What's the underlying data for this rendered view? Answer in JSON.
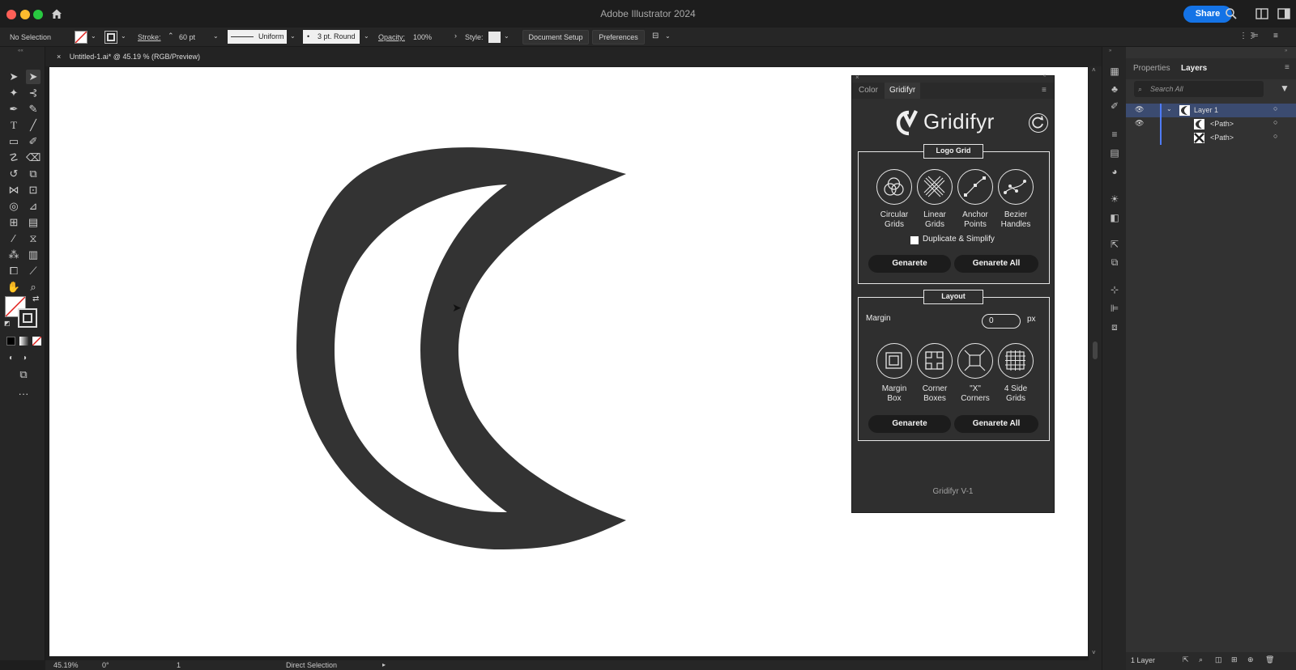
{
  "app": {
    "title": "Adobe Illustrator 2024",
    "share_label": "Share"
  },
  "controlbar": {
    "selection": "No Selection",
    "stroke_label": "Stroke:",
    "stroke_value": "60 pt",
    "profile": "Uniform",
    "brush": "3 pt. Round",
    "opacity_label": "Opacity:",
    "opacity_value": "100%",
    "style_label": "Style:",
    "document_setup": "Document Setup",
    "preferences": "Preferences"
  },
  "document": {
    "tab_title": "Untitled-1.ai* @ 45.19 % (RGB/Preview)"
  },
  "status": {
    "zoom": "45.19%",
    "rotation": "0°",
    "artboard": "1",
    "tool": "Direct Selection"
  },
  "layers_panel": {
    "tabs": [
      "Properties",
      "Layers"
    ],
    "search_placeholder": "Search All",
    "layers": [
      {
        "name": "Layer 1"
      },
      {
        "name": "<Path>"
      },
      {
        "name": "<Path>"
      }
    ],
    "footer": "1 Layer"
  },
  "gridifyr": {
    "tabs": [
      "Color",
      "Gridifyr"
    ],
    "logo_text": "Gridifyr",
    "logo_grid": {
      "title": "Logo Grid",
      "items": [
        {
          "line1": "Circular",
          "line2": "Grids"
        },
        {
          "line1": "Linear",
          "line2": "Grids"
        },
        {
          "line1": "Anchor",
          "line2": "Points"
        },
        {
          "line1": "Bezier",
          "line2": "Handles"
        }
      ],
      "checkbox_label": "Duplicate & Simplify",
      "generate": "Genarete",
      "generate_all": "Genarete All"
    },
    "layout": {
      "title": "Layout",
      "margin_label": "Margin",
      "margin_value": "0",
      "margin_unit": "px",
      "items": [
        {
          "line1": "Margin",
          "line2": "Box"
        },
        {
          "line1": "Corner",
          "line2": "Boxes"
        },
        {
          "line1": "\"X\"",
          "line2": "Corners"
        },
        {
          "line1": "4 Side",
          "line2": "Grids"
        }
      ],
      "generate": "Genarete",
      "generate_all": "Genarete All"
    },
    "version": "Gridifyr V-1"
  },
  "colors": {
    "accent": "#1473e6",
    "artwork": "#333333",
    "panel": "#2f2f2f"
  }
}
